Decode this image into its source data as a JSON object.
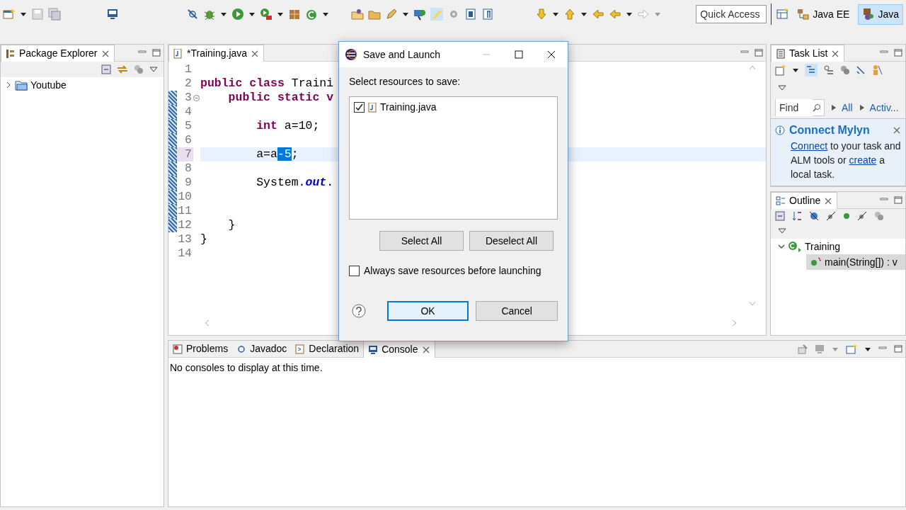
{
  "toolbar": {
    "quick_access": {
      "placeholder": "Quick Access"
    },
    "perspectives": [
      {
        "label": "Java EE",
        "selected": false
      },
      {
        "label": "Java",
        "selected": true
      }
    ]
  },
  "package_explorer": {
    "title": "Package Explorer",
    "tree": [
      {
        "label": "Youtube",
        "expanded": false
      }
    ]
  },
  "editor": {
    "tab": "*Training.java",
    "lines": [
      {
        "number": "1",
        "current": false,
        "foldable": false,
        "changed": false
      },
      {
        "number": "2",
        "current": false,
        "foldable": false,
        "changed": false,
        "segments": [
          {
            "kind": "keyword",
            "text": "public "
          },
          {
            "kind": "keyword",
            "text": "class "
          },
          {
            "kind": "plain",
            "text": "Traini"
          }
        ]
      },
      {
        "number": "3",
        "current": false,
        "foldable": true,
        "changed": true,
        "segments": [
          {
            "kind": "keyword",
            "text": "    public "
          },
          {
            "kind": "keyword",
            "text": "static "
          },
          {
            "kind": "keyword",
            "text": "v"
          }
        ]
      },
      {
        "number": "4",
        "current": false,
        "foldable": false,
        "changed": true
      },
      {
        "number": "5",
        "current": false,
        "foldable": false,
        "changed": true,
        "segments": [
          {
            "kind": "keyword",
            "text": "        int "
          },
          {
            "kind": "plain",
            "text": "a=10;"
          }
        ]
      },
      {
        "number": "6",
        "current": false,
        "foldable": false,
        "changed": true
      },
      {
        "number": "7",
        "current": true,
        "foldable": false,
        "changed": true,
        "segments": [
          {
            "kind": "plain",
            "text": "        a=a"
          },
          {
            "kind": "selection",
            "text": "-5"
          },
          {
            "kind": "plain",
            "text": ";"
          }
        ]
      },
      {
        "number": "8",
        "current": false,
        "foldable": false,
        "changed": true
      },
      {
        "number": "9",
        "current": false,
        "foldable": false,
        "changed": true,
        "segments": [
          {
            "kind": "plain",
            "text": "        System."
          },
          {
            "kind": "field",
            "text": "out"
          },
          {
            "kind": "plain",
            "text": "."
          }
        ]
      },
      {
        "number": "10",
        "current": false,
        "foldable": false,
        "changed": true
      },
      {
        "number": "11",
        "current": false,
        "foldable": false,
        "changed": true
      },
      {
        "number": "12",
        "current": false,
        "foldable": false,
        "changed": true,
        "segments": [
          {
            "kind": "plain",
            "text": "    }"
          }
        ]
      },
      {
        "number": "13",
        "current": false,
        "foldable": false,
        "changed": false,
        "segments": [
          {
            "kind": "plain",
            "text": "}"
          }
        ]
      },
      {
        "number": "14",
        "current": false,
        "foldable": false,
        "changed": false
      }
    ]
  },
  "task_list": {
    "title": "Task List",
    "find": {
      "placeholder": "Find"
    },
    "filters": [
      "All",
      "Activ..."
    ],
    "mylyn": {
      "title": "Connect Mylyn",
      "segments": [
        {
          "kind": "link",
          "text": "Connect"
        },
        {
          "kind": "text",
          "text": " to your task and ALM tools or "
        },
        {
          "kind": "link",
          "text": "create"
        },
        {
          "kind": "text",
          "text": " a local task."
        }
      ]
    }
  },
  "outline": {
    "title": "Outline",
    "tree": [
      {
        "label": "Training",
        "expanded": true,
        "selected": false,
        "children": [
          {
            "label": "main(String[]) : v",
            "selected": true
          }
        ]
      }
    ]
  },
  "bottom": {
    "tabs": [
      {
        "label": "Problems",
        "selected": false
      },
      {
        "label": "Javadoc",
        "selected": false
      },
      {
        "label": "Declaration",
        "selected": false
      },
      {
        "label": "Console",
        "selected": true
      }
    ],
    "message": "No consoles to display at this time."
  },
  "dialog": {
    "title": "Save and Launch",
    "prompt": "Select resources to save:",
    "resources": [
      {
        "label": "Training.java",
        "checked": true
      }
    ],
    "buttons": [
      "Select All",
      "Deselect All"
    ],
    "always_save": {
      "label": "Always save resources before launching",
      "checked": false
    },
    "actions": [
      {
        "label": "OK",
        "default": true
      },
      {
        "label": "Cancel",
        "default": false
      }
    ]
  }
}
